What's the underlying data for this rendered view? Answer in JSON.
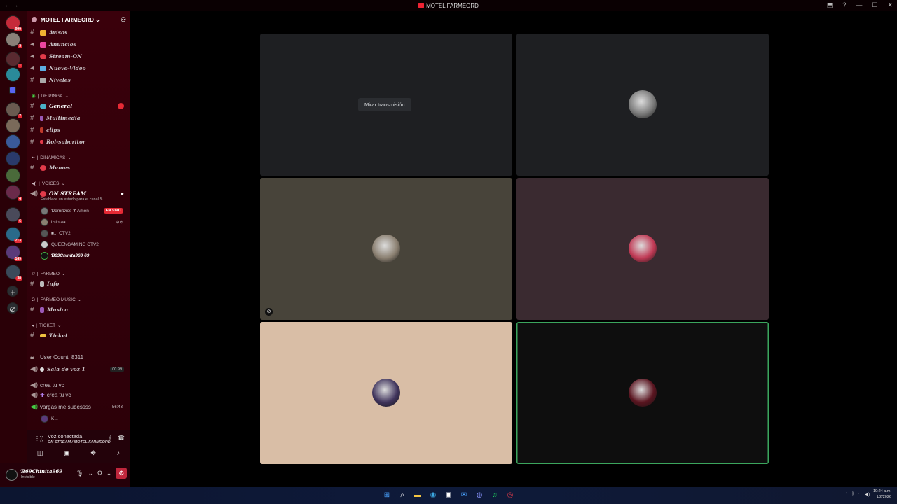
{
  "window": {
    "title": "MOTEL FARMEORD",
    "back_glyph": "←  →",
    "controls": [
      "⬒",
      "?",
      "—",
      "☐",
      "✕"
    ]
  },
  "servers": [
    {
      "badge": "999"
    },
    {
      "badge": "3"
    },
    {
      "badge": "1"
    },
    {
      "badge": ""
    },
    {
      "badge": ""
    },
    {
      "badge": "7"
    },
    {
      "badge": ""
    },
    {
      "badge": ""
    },
    {
      "badge": ""
    },
    {
      "badge": ""
    },
    {
      "badge": "4"
    },
    {
      "badge": "6"
    },
    {
      "badge": "213"
    },
    {
      "badge": "149"
    },
    {
      "badge": "30"
    }
  ],
  "guild": {
    "name": "MOTEL FARMEORD",
    "chevron": "⌄"
  },
  "channels_top": [
    {
      "label": "Avisos",
      "color": "#f0b232"
    },
    {
      "label": "Anuncios",
      "color": "#eb459e"
    },
    {
      "label": "Stream-ON",
      "color": "#e23b4a"
    },
    {
      "label": "Nuevo-Video",
      "color": "#5dade2"
    },
    {
      "label": "Niveles",
      "color": "#aaaaaa"
    }
  ],
  "cat_depinga": "DE PINGA",
  "channels_depinga": [
    {
      "label": "General",
      "color": "#4ab0c6",
      "mention": "1"
    },
    {
      "label": "Multimedia",
      "color": "#9b59b6",
      "mention": ""
    },
    {
      "label": "clips",
      "color": "#c0392b",
      "mention": ""
    },
    {
      "label": "Rol-subcritor",
      "color": "#e23b4a",
      "mention": ""
    }
  ],
  "cat_dinamicas": "DINAMICAS",
  "channels_dinamicas": [
    {
      "label": "Memes",
      "color": "#e23b4a"
    }
  ],
  "cat_voices": "VOICES",
  "voice_channel": {
    "label": "ON STREAM",
    "status_hint": "Establece un estado para el canal"
  },
  "voice_users": [
    {
      "name": "ƊɑmiƊios  Ɏ Amén",
      "live": "EN VIVO"
    },
    {
      "name": "ltsiotaa",
      "live": ""
    },
    {
      "name": "■...  CTV2",
      "live": ""
    },
    {
      "name": "QUEENGAMING  CTV2",
      "live": ""
    },
    {
      "name": "Ɓ69Chinita969  69",
      "live": ""
    }
  ],
  "cat_farmeo": "FARMEO",
  "channels_farmeo": [
    {
      "label": "Info",
      "color": "#bbbbbb"
    }
  ],
  "cat_farmeo_music": "FARMEO MUSIC",
  "channels_music": [
    {
      "label": "Musica",
      "color": "#9b59b6"
    }
  ],
  "cat_ticket": "TICKET",
  "channels_ticket": [
    {
      "label": "Ticket",
      "color": "#f0c040"
    }
  ],
  "user_count": "User Count: 8311",
  "sala": {
    "label": "Sala de voz 1",
    "counts": "00  99"
  },
  "vc_create": {
    "label1": "crea tu vc",
    "label2": "crea tu vc"
  },
  "vargas": {
    "label": "vargas me subessss",
    "time": "56:43"
  },
  "vargas_user": "K...",
  "voice_panel": {
    "title": "Voz conectada",
    "sub": "ON STREAM / MOTEL FARMEORD"
  },
  "user": {
    "name": "Ɓ69Chinita969",
    "status": "Invisible"
  },
  "stage": {
    "watch_label": "Mirar transmisión",
    "tiles": [
      {
        "bg": "#1e1f22",
        "avatar": "",
        "watch": true
      },
      {
        "bg": "#1e1f22",
        "avatar": "#7a7a7a"
      },
      {
        "bg": "#48443a",
        "avatar": "#8a7f70"
      },
      {
        "bg": "#3a2a30",
        "avatar": "#c03a55"
      },
      {
        "bg": "#d9bea6",
        "avatar": "#40345c"
      },
      {
        "bg": "#0e0e0e",
        "avatar": "#5a1520",
        "speaking": true
      }
    ]
  },
  "taskbar": {
    "icons": [
      "⊞",
      "⌕",
      "▬",
      "◉",
      "▣",
      "✉",
      "◍",
      "♫",
      "◎"
    ],
    "clock_time": "10:24 a.m.",
    "clock_date": "1/2/2026"
  }
}
